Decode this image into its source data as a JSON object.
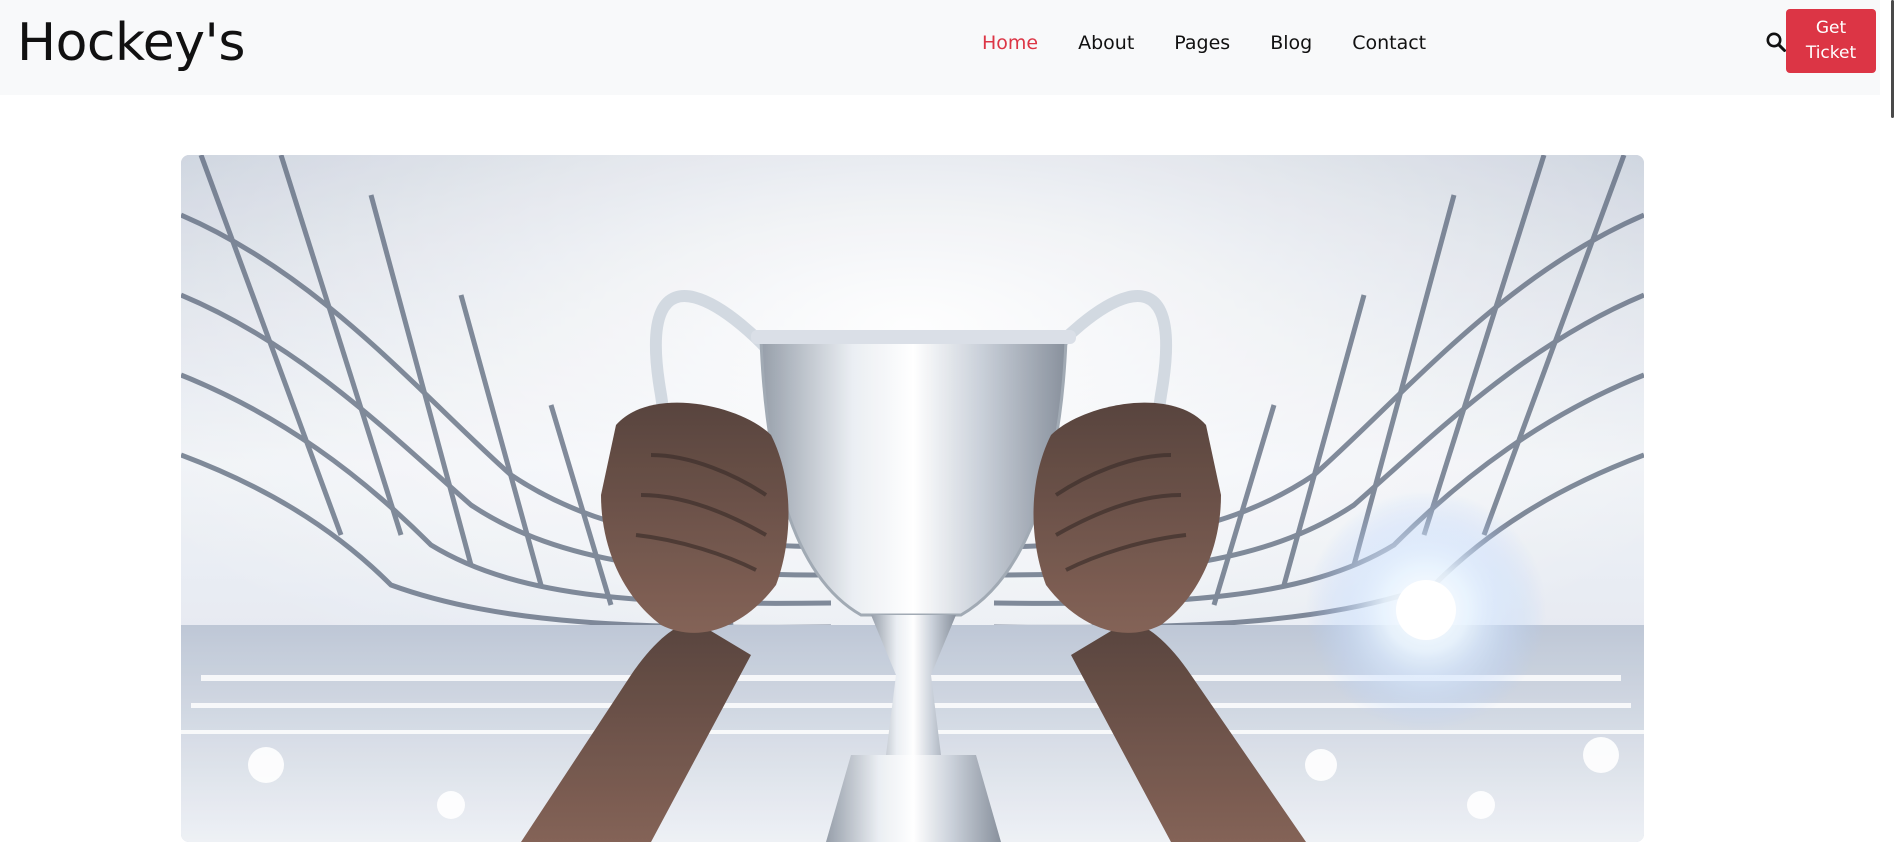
{
  "header": {
    "brand": "Hockey's",
    "nav": [
      {
        "label": "Home",
        "active": true
      },
      {
        "label": "About",
        "active": false
      },
      {
        "label": "Pages",
        "active": false
      },
      {
        "label": "Blog",
        "active": false
      },
      {
        "label": "Contact",
        "active": false
      }
    ],
    "search_icon": "search-icon",
    "ticket_label": "Get Ticket"
  },
  "hero": {
    "image": "trophy-stadium-image"
  },
  "colors": {
    "accent": "#dc3545",
    "nav_bg": "#f8f9fa",
    "text": "#111111"
  }
}
